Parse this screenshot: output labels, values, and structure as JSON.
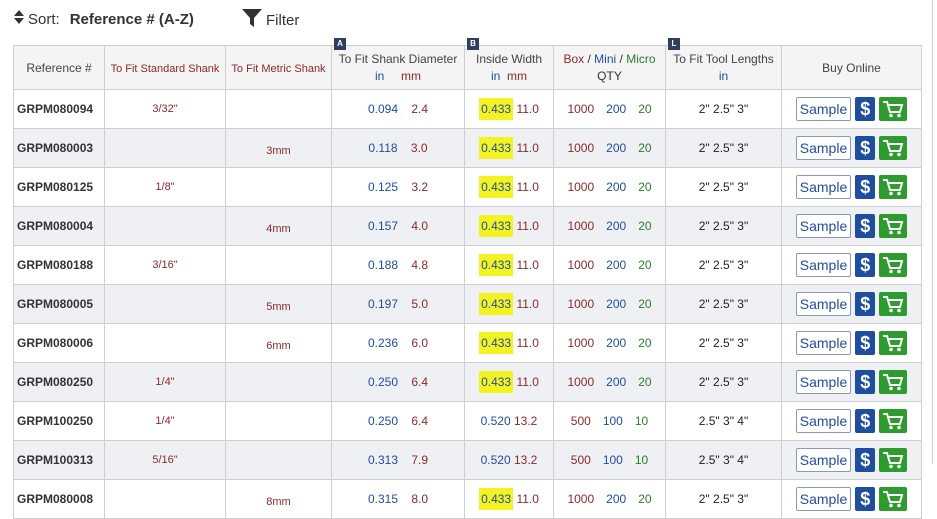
{
  "toolbar": {
    "sort_label": "Sort:",
    "sort_value": "Reference # (A-Z)",
    "filter_label": "Filter"
  },
  "headers": {
    "reference": "Reference #",
    "fit_standard": "To Fit Standard Shank",
    "fit_metric": "To Fit Metric Shank",
    "shank_diameter": "To Fit Shank Diameter",
    "shank_diameter_in": "in",
    "shank_diameter_mm": "mm",
    "shank_badge": "A",
    "inside_width": "Inside Width",
    "inside_width_in": "in",
    "inside_width_mm": "mm",
    "inside_badge": "B",
    "box": "Box",
    "sep1": "/",
    "mini": "Mini",
    "sep2": "/",
    "micro": "Micro",
    "qty": "QTY",
    "tool_lengths": "To Fit Tool Lengths",
    "tool_lengths_in": "in",
    "tool_badge": "L",
    "buy_online": "Buy Online"
  },
  "buttons": {
    "sample": "Sample",
    "dollar": "$"
  },
  "colors": {
    "blue": "#1f4e9e",
    "red": "#8b2a2a",
    "green": "#2d7d2d",
    "highlight": "#f3f322",
    "cart_green": "#2e9b2e"
  },
  "icons": [
    "sort-icon",
    "filter-icon",
    "dollar-icon",
    "cart-icon"
  ],
  "rows": [
    {
      "ref": "GRPM080094",
      "std": "3/32\"",
      "metric": "",
      "dia_in": "0.094",
      "dia_mm": "2.4",
      "w_in": "0.433",
      "w_mm": "11.0",
      "box": "1000",
      "mini": "200",
      "micro": "20",
      "lengths": "2\" 2.5\" 3\""
    },
    {
      "ref": "GRPM080003",
      "std": "",
      "metric": "3mm",
      "dia_in": "0.118",
      "dia_mm": "3.0",
      "w_in": "0.433",
      "w_mm": "11.0",
      "box": "1000",
      "mini": "200",
      "micro": "20",
      "lengths": "2\" 2.5\" 3\""
    },
    {
      "ref": "GRPM080125",
      "std": "1/8\"",
      "metric": "",
      "dia_in": "0.125",
      "dia_mm": "3.2",
      "w_in": "0.433",
      "w_mm": "11.0",
      "box": "1000",
      "mini": "200",
      "micro": "20",
      "lengths": "2\" 2.5\" 3\""
    },
    {
      "ref": "GRPM080004",
      "std": "",
      "metric": "4mm",
      "dia_in": "0.157",
      "dia_mm": "4.0",
      "w_in": "0.433",
      "w_mm": "11.0",
      "box": "1000",
      "mini": "200",
      "micro": "20",
      "lengths": "2\" 2.5\" 3\""
    },
    {
      "ref": "GRPM080188",
      "std": "3/16\"",
      "metric": "",
      "dia_in": "0.188",
      "dia_mm": "4.8",
      "w_in": "0.433",
      "w_mm": "11.0",
      "box": "1000",
      "mini": "200",
      "micro": "20",
      "lengths": "2\" 2.5\" 3\""
    },
    {
      "ref": "GRPM080005",
      "std": "",
      "metric": "5mm",
      "dia_in": "0.197",
      "dia_mm": "5.0",
      "w_in": "0.433",
      "w_mm": "11.0",
      "box": "1000",
      "mini": "200",
      "micro": "20",
      "lengths": "2\" 2.5\" 3\""
    },
    {
      "ref": "GRPM080006",
      "std": "",
      "metric": "6mm",
      "dia_in": "0.236",
      "dia_mm": "6.0",
      "w_in": "0.433",
      "w_mm": "11.0",
      "box": "1000",
      "mini": "200",
      "micro": "20",
      "lengths": "2\" 2.5\" 3\""
    },
    {
      "ref": "GRPM080250",
      "std": "1/4\"",
      "metric": "",
      "dia_in": "0.250",
      "dia_mm": "6.4",
      "w_in": "0.433",
      "w_mm": "11.0",
      "box": "1000",
      "mini": "200",
      "micro": "20",
      "lengths": "2\" 2.5\" 3\""
    },
    {
      "ref": "GRPM100250",
      "std": "1/4\"",
      "metric": "",
      "dia_in": "0.250",
      "dia_mm": "6.4",
      "w_in": "0.520",
      "w_mm": "13.2",
      "box": "500",
      "mini": "100",
      "micro": "10",
      "lengths": "2.5\" 3\" 4\""
    },
    {
      "ref": "GRPM100313",
      "std": "5/16\"",
      "metric": "",
      "dia_in": "0.313",
      "dia_mm": "7.9",
      "w_in": "0.520",
      "w_mm": "13.2",
      "box": "500",
      "mini": "100",
      "micro": "10",
      "lengths": "2.5\" 3\" 4\""
    },
    {
      "ref": "GRPM080008",
      "std": "",
      "metric": "8mm",
      "dia_in": "0.315",
      "dia_mm": "8.0",
      "w_in": "0.433",
      "w_mm": "11.0",
      "box": "1000",
      "mini": "200",
      "micro": "20",
      "lengths": "2\" 2.5\" 3\""
    }
  ]
}
